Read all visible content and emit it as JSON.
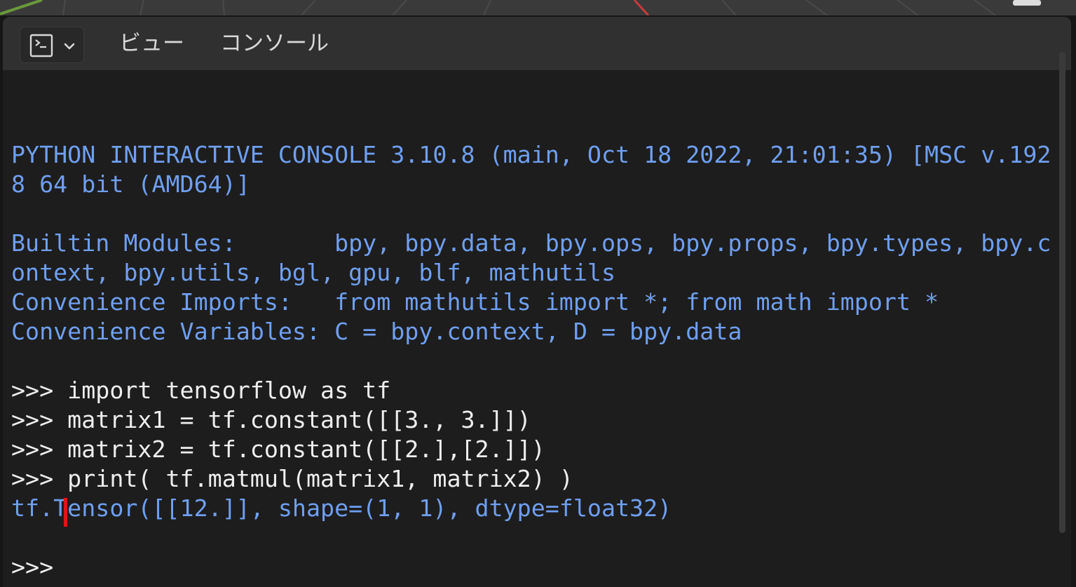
{
  "header": {
    "editor_type_icon": "console-icon",
    "editor_type_dropdown_icon": "chevron-down-icon",
    "menu": [
      "ビュー",
      "コンソール"
    ]
  },
  "console": {
    "lines": [
      {
        "text": "PYTHON INTERACTIVE CONSOLE 3.10.8 (main, Oct 18 2022, 21:01:35) [MSC v.192",
        "style": "output"
      },
      {
        "text": "8 64 bit (AMD64)]",
        "style": "output"
      },
      {
        "text": "",
        "style": "output"
      },
      {
        "text": "Builtin Modules:       bpy, bpy.data, bpy.ops, bpy.props, bpy.types, bpy.c",
        "style": "output"
      },
      {
        "text": "ontext, bpy.utils, bgl, gpu, blf, mathutils",
        "style": "output"
      },
      {
        "text": "Convenience Imports:   from mathutils import *; from math import *",
        "style": "output"
      },
      {
        "text": "Convenience Variables: C = bpy.context, D = bpy.data",
        "style": "output"
      },
      {
        "text": "",
        "style": "output"
      },
      {
        "text": ">>> import tensorflow as tf",
        "style": "input"
      },
      {
        "text": ">>> matrix1 = tf.constant([[3., 3.]])",
        "style": "input"
      },
      {
        "text": ">>> matrix2 = tf.constant([[2.],[2.]])",
        "style": "input"
      },
      {
        "text": ">>> print( tf.matmul(matrix1, matrix2) )",
        "style": "input"
      },
      {
        "text": "tf.Tensor([[12.]], shape=(1, 1), dtype=float32)",
        "style": "output"
      },
      {
        "text": "",
        "style": "output"
      },
      {
        "text": ">>> ",
        "style": "prompt"
      }
    ]
  },
  "colors": {
    "output_text": "#6f9ff0",
    "input_text": "#eeeeee",
    "cursor": "#e01515",
    "background": "#1d1d1d",
    "header": "#303030"
  }
}
